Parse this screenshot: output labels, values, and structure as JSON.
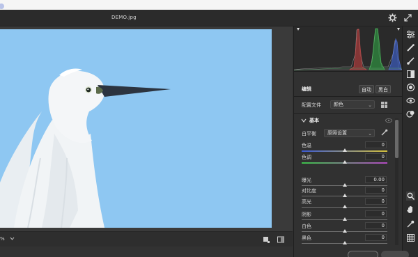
{
  "window": {
    "filename": "DEMO.jpg"
  },
  "canvas": {
    "zoom": "%"
  },
  "panel": {
    "edit": {
      "title": "编辑",
      "auto_label": "自动",
      "bw_label": "黑白"
    },
    "profile": {
      "label": "配置文件",
      "value": "颜色"
    },
    "basic": {
      "title": "基本",
      "wb_label": "白平衡",
      "wb_value": "原照设置",
      "sliders": [
        {
          "label": "色温",
          "value": "0",
          "position": 0.5
        },
        {
          "label": "色调",
          "value": "0",
          "position": 0.5
        },
        {
          "label": "曝光",
          "value": "0.00",
          "position": 0.5
        },
        {
          "label": "对比度",
          "value": "0",
          "position": 0.5
        },
        {
          "label": "高光",
          "value": "0",
          "position": 0.5
        },
        {
          "label": "阴影",
          "value": "0",
          "position": 0.5
        },
        {
          "label": "白色",
          "value": "0",
          "position": 0.5
        },
        {
          "label": "黑色",
          "value": "0",
          "position": 0.5
        }
      ]
    }
  },
  "colors": {
    "sky": "#8ec7f2",
    "panel_bg": "#313131",
    "temp_gradient_from": "#3c5bd6",
    "temp_gradient_to": "#d6c23c",
    "tint_gradient_from": "#3cc24a",
    "tint_gradient_to": "#b44ac4"
  },
  "icons": [
    "gear-icon",
    "expand-icon",
    "sliders-icon",
    "brush-icon",
    "heal-icon",
    "gradient-icon",
    "radial-icon",
    "redeye-icon",
    "presets-icon",
    "zoom-icon",
    "hand-icon",
    "eyedropper-icon",
    "grid-icon"
  ]
}
